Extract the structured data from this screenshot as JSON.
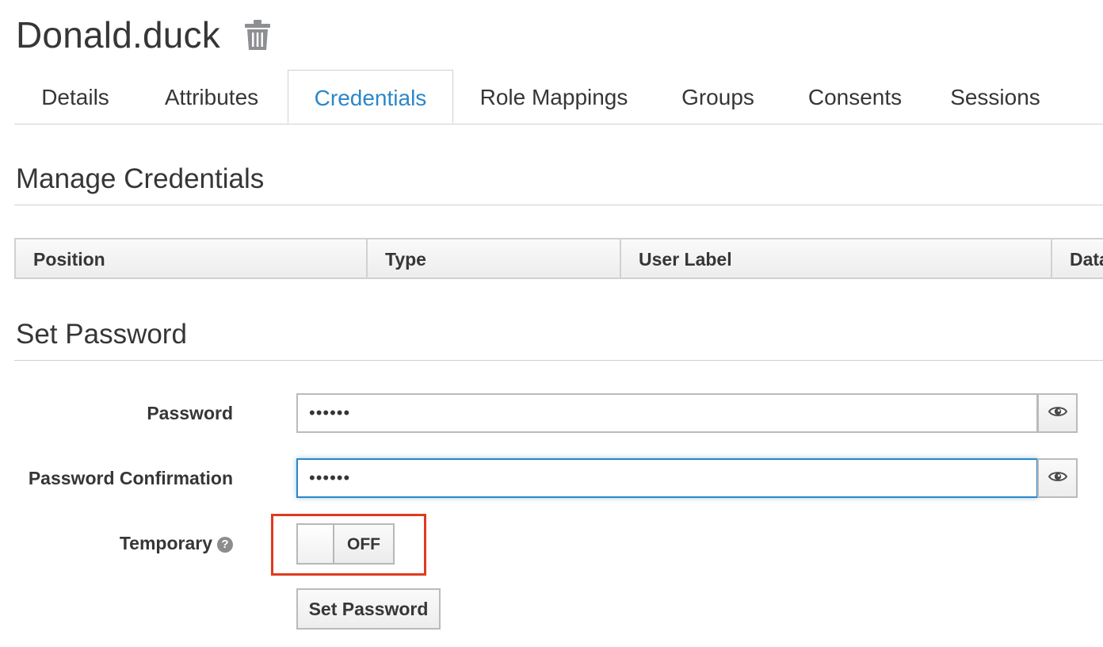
{
  "header": {
    "title": "Donald.duck",
    "delete_icon": "trash-icon"
  },
  "tabs": [
    {
      "label": "Details",
      "active": false
    },
    {
      "label": "Attributes",
      "active": false
    },
    {
      "label": "Credentials",
      "active": true
    },
    {
      "label": "Role Mappings",
      "active": false
    },
    {
      "label": "Groups",
      "active": false
    },
    {
      "label": "Consents",
      "active": false
    },
    {
      "label": "Sessions",
      "active": false
    }
  ],
  "manage": {
    "title": "Manage Credentials",
    "columns": [
      "Position",
      "Type",
      "User Label",
      "Data"
    ]
  },
  "set_password": {
    "title": "Set Password",
    "password_label": "Password",
    "password_value": "••••••",
    "confirmation_label": "Password Confirmation",
    "confirmation_value": "••••••",
    "temporary_label": "Temporary",
    "help_icon": "question-circle-icon",
    "temporary_state": "OFF",
    "submit_label": "Set Password",
    "show_password_icon": "eye-icon"
  },
  "colors": {
    "accent": "#2b87c8",
    "highlight": "#e03a1f",
    "text": "#363636"
  }
}
